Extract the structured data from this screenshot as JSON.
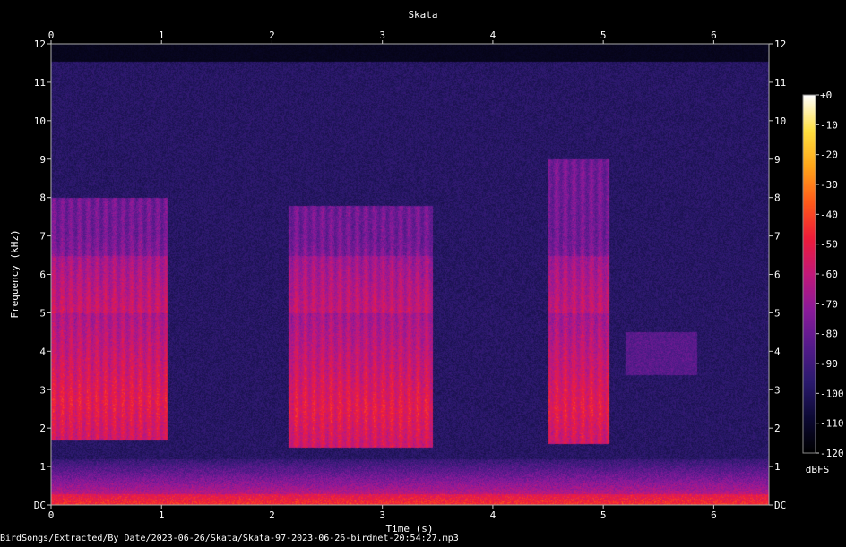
{
  "chart_data": {
    "type": "heatmap",
    "title": "Skata",
    "xlabel": "Time (s)",
    "ylabel": "Frequency (kHz)",
    "xlim": [
      0,
      6.5
    ],
    "ylim": [
      0,
      12
    ],
    "x_ticks": [
      "0",
      "1",
      "2",
      "3",
      "4",
      "5",
      "6"
    ],
    "y_ticks": [
      "DC",
      "1",
      "2",
      "3",
      "4",
      "5",
      "6",
      "7",
      "8",
      "9",
      "10",
      "11",
      "12"
    ],
    "colorbar": {
      "label": "dBFS",
      "range": [
        -120,
        0
      ],
      "ticks": [
        "+0",
        "-10",
        "-20",
        "-30",
        "-40",
        "-50",
        "-60",
        "-70",
        "-80",
        "-90",
        "-100",
        "-110",
        "-120"
      ]
    },
    "calls": [
      {
        "t_start": 0.0,
        "t_end": 1.05,
        "f_low": 1.7,
        "f_high": 8.0,
        "peak_f": 2.7
      },
      {
        "t_start": 2.15,
        "t_end": 3.45,
        "f_low": 1.5,
        "f_high": 7.8,
        "peak_f": 2.5
      },
      {
        "t_start": 4.5,
        "t_end": 5.05,
        "f_low": 1.6,
        "f_high": 9.0,
        "peak_f": 2.5
      }
    ],
    "colormap": [
      "#000000",
      "#0d0a35",
      "#2b1a6e",
      "#551a8b",
      "#8b1a9b",
      "#c2187a",
      "#ee1c3b",
      "#ff5a1a",
      "#ffa51a",
      "#ffe040",
      "#ffffff"
    ]
  },
  "footer": {
    "path": "BirdSongs/Extracted/By_Date/2023-06-26/Skata/Skata-97-2023-06-26-birdnet-20:54:27.mp3"
  }
}
